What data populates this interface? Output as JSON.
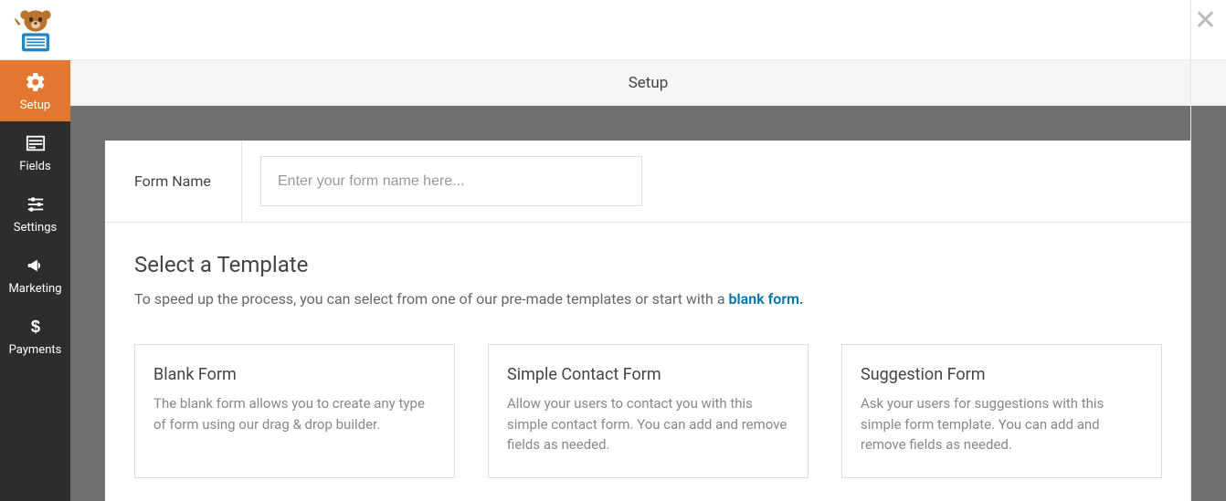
{
  "titlebar": {
    "title": "Setup"
  },
  "sidebar": {
    "items": [
      {
        "label": "Setup"
      },
      {
        "label": "Fields"
      },
      {
        "label": "Settings"
      },
      {
        "label": "Marketing"
      },
      {
        "label": "Payments"
      }
    ]
  },
  "form_name": {
    "label": "Form Name",
    "placeholder": "Enter your form name here...",
    "value": ""
  },
  "select_template": {
    "heading": "Select a Template",
    "subtext_pre": "To speed up the process, you can select from one of our pre-made templates or start with a ",
    "subtext_link": "blank form."
  },
  "templates": [
    {
      "title": "Blank Form",
      "desc": "The blank form allows you to create any type of form using our drag & drop builder."
    },
    {
      "title": "Simple Contact Form",
      "desc": "Allow your users to contact you with this simple contact form. You can add and remove fields as needed."
    },
    {
      "title": "Suggestion Form",
      "desc": "Ask your users for suggestions with this simple form template. You can add and remove fields as needed."
    }
  ]
}
